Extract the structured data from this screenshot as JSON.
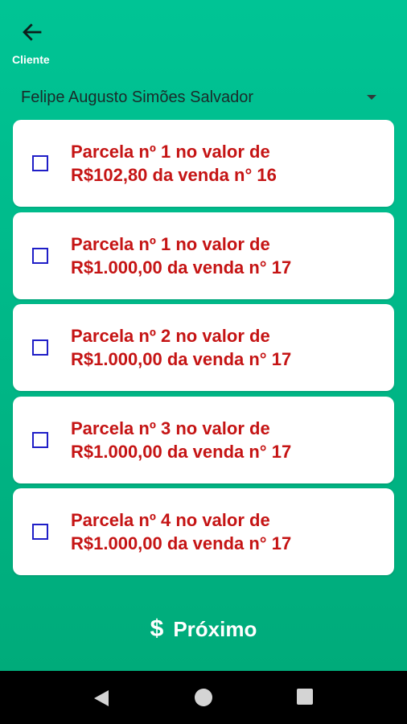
{
  "header": {
    "back_label": "Cliente"
  },
  "customer_select": {
    "selected": "Felipe Augusto Simões Salvador"
  },
  "installments": [
    {
      "line1": "Parcela nº 1 no valor de",
      "line2": "R$102,80 da venda n° 16",
      "checked": false
    },
    {
      "line1": "Parcela nº 1 no valor de",
      "line2": "R$1.000,00 da venda n° 17",
      "checked": false
    },
    {
      "line1": "Parcela nº 2 no valor de",
      "line2": "R$1.000,00 da venda n° 17",
      "checked": false
    },
    {
      "line1": "Parcela nº 3 no valor de",
      "line2": "R$1.000,00 da venda n° 17",
      "checked": false
    },
    {
      "line1": "Parcela nº 4 no valor de",
      "line2": "R$1.000,00 da venda n° 17",
      "checked": false
    }
  ],
  "footer": {
    "icon": "$",
    "label": "Próximo"
  },
  "colors": {
    "background_top": "#00c495",
    "background_bottom": "#00a978",
    "card_text": "#c51414",
    "checkbox_border": "#1f1ec7"
  }
}
